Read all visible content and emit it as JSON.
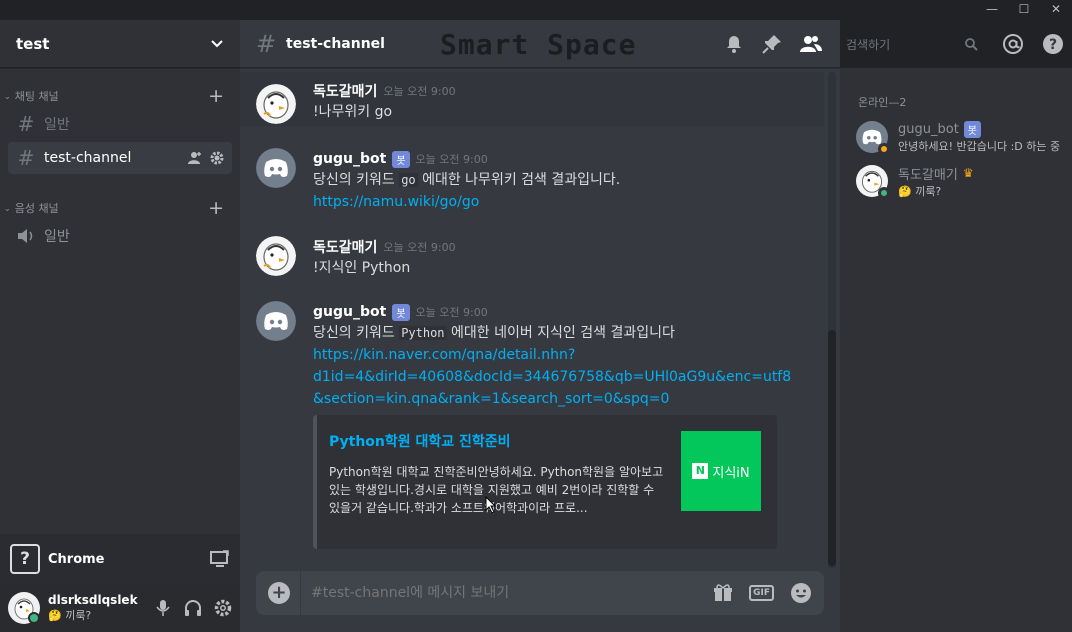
{
  "window": {
    "minimize": "—",
    "maximize": "☐",
    "close": "✕"
  },
  "server": {
    "name": "test"
  },
  "sidebar": {
    "categories": [
      {
        "label": "채팅 채널",
        "channels": [
          {
            "name": "일반"
          },
          {
            "name": "test-channel"
          }
        ]
      },
      {
        "label": "음성 채널",
        "channels": [
          {
            "name": "일반"
          }
        ]
      }
    ]
  },
  "activity": {
    "icon_text": "?",
    "name": "Chrome"
  },
  "user": {
    "name": "dlsrksdlqslek",
    "status": "🤔 끼룩?"
  },
  "channel": {
    "title": "test-channel"
  },
  "watermark": "Smart Space",
  "messages": [
    {
      "author": "독도갈매기",
      "timestamp": "오늘 오전 9:00",
      "text": "!나무위키 go"
    },
    {
      "author": "gugu_bot",
      "bot_tag": "봇",
      "timestamp": "오늘 오전 9:00",
      "text_pre": "당신의 키워드 ",
      "text_code": "go",
      "text_post": " 에대한 나무위키 검색 결과입니다.",
      "link": "https://namu.wiki/go/go"
    },
    {
      "author": "독도갈매기",
      "timestamp": "오늘 오전 9:00",
      "text": "!지식인 Python"
    },
    {
      "author": "gugu_bot",
      "bot_tag": "봇",
      "timestamp": "오늘 오전 9:00",
      "text_pre": "당신의 키워드 ",
      "text_code": "Python",
      "text_post": " 에대한 네이버 지식인 검색 결과입니다",
      "link_lines": [
        "https://kin.naver.com/qna/detail.nhn?",
        "d1id=4&dirId=40608&docId=344676758&qb=UHl0aG9u&enc=utf8",
        "&section=kin.qna&rank=1&search_sort=0&spq=0"
      ],
      "embed": {
        "title": "Python학원 대학교 진학준비",
        "description": "Python학원 대학교 진학준비안녕하세요. Python학원을 알아보고 있는 학생입니다.경시로 대학을 지원했고 예비 2번이라 진학할 수 있을거 같습니다.학과가 소프트웨어학과이라 프로...",
        "thumb_logo": "N",
        "thumb_text": "지식iN"
      }
    }
  ],
  "composer": {
    "placeholder": "#test-channel에 메시지 보내기"
  },
  "search": {
    "placeholder": "검색하기"
  },
  "members": {
    "category": "온라인—2",
    "list": [
      {
        "name": "gugu_bot",
        "tag": "봇",
        "sub": "안녕하세요! 반갑습니다 :D 하는 중"
      },
      {
        "name": "독도갈매기",
        "sub": "🤔 끼룩?"
      }
    ]
  },
  "colors": {
    "accent": "#7289da",
    "link": "#00b0f4",
    "naver": "#03c75a",
    "online": "#43b581",
    "idle": "#faa61a"
  }
}
